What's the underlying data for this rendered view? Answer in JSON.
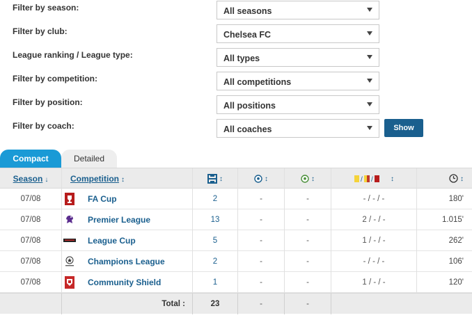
{
  "filters": [
    {
      "label": "Filter by season:",
      "value": "All seasons"
    },
    {
      "label": "Filter by club:",
      "value": "Chelsea FC"
    },
    {
      "label": "League ranking / League type:",
      "value": "All types"
    },
    {
      "label": "Filter by competition:",
      "value": "All competitions"
    },
    {
      "label": "Filter by position:",
      "value": "All positions"
    },
    {
      "label": "Filter by coach:",
      "value": "All coaches"
    }
  ],
  "show_button": "Show",
  "tabs": {
    "compact": "Compact",
    "detailed": "Detailed"
  },
  "table": {
    "headers": {
      "season": "Season",
      "competition": "Competition",
      "apps_icon": "appearances-icon",
      "goals_icon": "goals-icon",
      "assists_icon": "assists-icon",
      "cards_icon": "cards-icon",
      "minutes_icon": "clock-icon"
    },
    "rows": [
      {
        "season": "07/08",
        "competition": "FA Cup",
        "apps": "2",
        "goals": "-",
        "assists": "-",
        "cards": "- / - / -",
        "minutes": "180'"
      },
      {
        "season": "07/08",
        "competition": "Premier League",
        "apps": "13",
        "goals": "-",
        "assists": "-",
        "cards": "2 / - / -",
        "minutes": "1.015'"
      },
      {
        "season": "07/08",
        "competition": "League Cup",
        "apps": "5",
        "goals": "-",
        "assists": "-",
        "cards": "1 / - / -",
        "minutes": "262'"
      },
      {
        "season": "07/08",
        "competition": "Champions League",
        "apps": "2",
        "goals": "-",
        "assists": "-",
        "cards": "- / - / -",
        "minutes": "106'"
      },
      {
        "season": "07/08",
        "competition": "Community Shield",
        "apps": "1",
        "goals": "-",
        "assists": "-",
        "cards": "1 / - / -",
        "minutes": "120'"
      }
    ],
    "total": {
      "label": "Total :",
      "apps": "23",
      "goals": "-",
      "assists": "-"
    }
  },
  "colors": {
    "accent": "#1a9ad6",
    "link": "#1a5f8e",
    "button": "#1a5f8e"
  }
}
